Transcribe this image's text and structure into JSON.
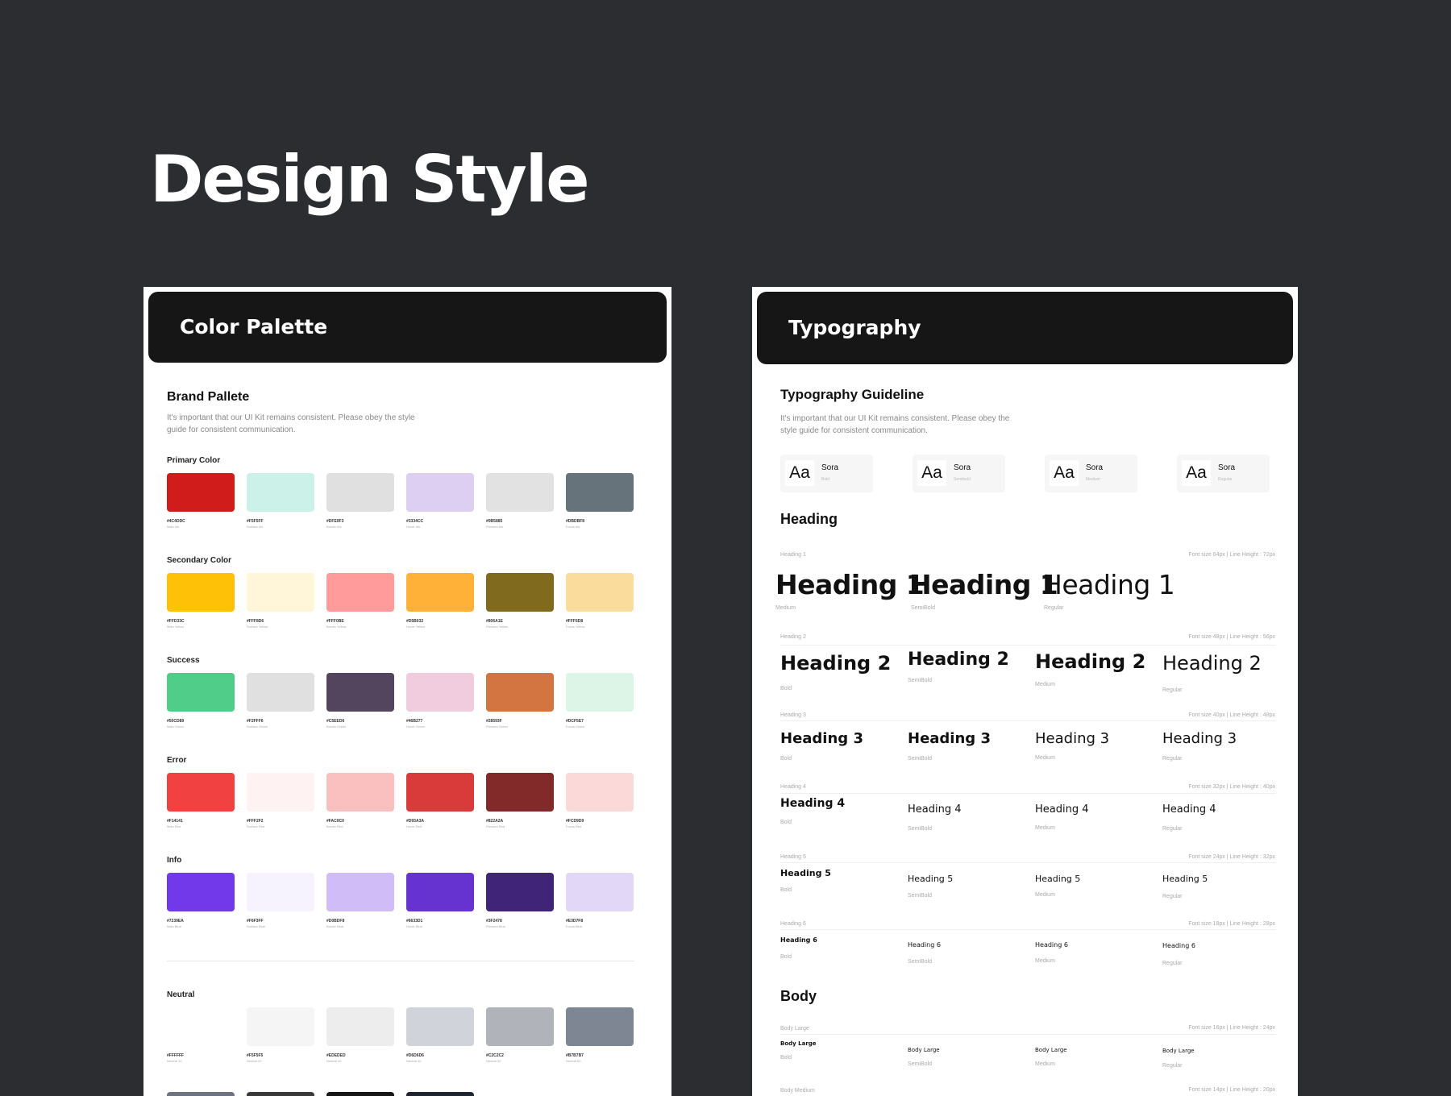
{
  "page": {
    "title": "Design Style"
  },
  "color_palette": {
    "header": "Color Palette",
    "title": "Brand Pallete",
    "description": "It's important that our UI Kit remains consistent. Please obey the style guide for consistent communication.",
    "groups": [
      {
        "label": "Primary Color",
        "swatches": [
          {
            "color": "#D11C1C",
            "hex": "#4C4DDC",
            "name": "Main Iris"
          },
          {
            "color": "#CBF1E8",
            "hex": "#F5F5FF",
            "name": "Surface Iris"
          },
          {
            "color": "#E0E0E0",
            "hex": "#DFE0F3",
            "name": "Border Iris"
          },
          {
            "color": "#DCCFF1",
            "hex": "#3334CC",
            "name": "Hover Iris"
          },
          {
            "color": "#E2E2E2",
            "hex": "#0B5885",
            "name": "Pressed Iris"
          },
          {
            "color": "#66737A",
            "hex": "#DBDBF8",
            "name": "Focus Iris"
          }
        ]
      },
      {
        "label": "Secondary Color",
        "swatches": [
          {
            "color": "#FFC107",
            "hex": "#FFD33C",
            "name": "Main Yellow"
          },
          {
            "color": "#FFF6DA",
            "hex": "#FFF8D6",
            "name": "Surface Yellow"
          },
          {
            "color": "#FF9B9B",
            "hex": "#FFF0BE",
            "name": "Border Yellow"
          },
          {
            "color": "#FFB237",
            "hex": "#D5B032",
            "name": "Hover Yellow"
          },
          {
            "color": "#806A1E",
            "hex": "#806A1E",
            "name": "Pressed Yellow"
          },
          {
            "color": "#FADD9D",
            "hex": "#FFF6D8",
            "name": "Focus Yellow"
          }
        ]
      },
      {
        "label": "Success",
        "swatches": [
          {
            "color": "#50CD89",
            "hex": "#50CD89",
            "name": "Main Green"
          },
          {
            "color": "#E0E0E0",
            "hex": "#F2FFF6",
            "name": "Surface Green"
          },
          {
            "color": "#54455F",
            "hex": "#C5EED6",
            "name": "Border Green"
          },
          {
            "color": "#F0CCDE",
            "hex": "#46B277",
            "name": "Hover Green"
          },
          {
            "color": "#D27540",
            "hex": "#28593F",
            "name": "Pressed Green"
          },
          {
            "color": "#DCF5E7",
            "hex": "#DCF5E7",
            "name": "Focus Green"
          }
        ]
      },
      {
        "label": "Error",
        "swatches": [
          {
            "color": "#F14141",
            "hex": "#F14141",
            "name": "Main Red"
          },
          {
            "color": "#FFF2F2",
            "hex": "#FFF2F2",
            "name": "Surface Red"
          },
          {
            "color": "#FAC0C0",
            "hex": "#FAC0C0",
            "name": "Border Red"
          },
          {
            "color": "#D93A3A",
            "hex": "#D93A3A",
            "name": "Hover Red"
          },
          {
            "color": "#822A2A",
            "hex": "#822A2A",
            "name": "Pressed Red"
          },
          {
            "color": "#FCD9D9",
            "hex": "#FCD9D9",
            "name": "Focus Red"
          }
        ]
      },
      {
        "label": "Info",
        "swatches": [
          {
            "color": "#7239EA",
            "hex": "#7239EA",
            "name": "Main Blue"
          },
          {
            "color": "#F6F3FF",
            "hex": "#F6F3FF",
            "name": "Surface Blue"
          },
          {
            "color": "#D0BDF8",
            "hex": "#D0BDF8",
            "name": "Border Blue"
          },
          {
            "color": "#6633D1",
            "hex": "#6633D1",
            "name": "Hover Blue"
          },
          {
            "color": "#3F2478",
            "hex": "#3F2478",
            "name": "Pressed Blue"
          },
          {
            "color": "#E3D7F8",
            "hex": "#E3D7F8",
            "name": "Focus Blue"
          }
        ]
      },
      {
        "label": "Neutral",
        "swatches": [
          {
            "color": "#FFFFFF",
            "hex": "#FFFFFF",
            "name": "Neutral 10"
          },
          {
            "color": "#F5F5F5",
            "hex": "#F5F5F5",
            "name": "Neutral 20"
          },
          {
            "color": "#EDEDED",
            "hex": "#EDEDED",
            "name": "Neutral 30"
          },
          {
            "color": "#D0D3D9",
            "hex": "#D6D6D6",
            "name": "Neutral 40"
          },
          {
            "color": "#B1B3BA",
            "hex": "#C2C2C2",
            "name": "Neutral 50"
          },
          {
            "color": "#7E8593",
            "hex": "#B7B7B7",
            "name": "Neutral 60"
          }
        ]
      }
    ],
    "neutral_extra": [
      "#6E7380",
      "#3A3A3A",
      "#161616",
      "#1E2530"
    ]
  },
  "typography": {
    "header": "Typography",
    "title": "Typography Guideline",
    "description": "It's important that our UI Kit remains consistent. Please obey the style guide for consistent communication.",
    "font_cards": [
      {
        "aa": "Aa",
        "name": "Sora",
        "weight": "Bold"
      },
      {
        "aa": "Aa",
        "name": "Sora",
        "weight": "Semibold"
      },
      {
        "aa": "Aa",
        "name": "Sora",
        "weight": "Medium"
      },
      {
        "aa": "Aa",
        "name": "Sora",
        "weight": "Regular"
      }
    ],
    "heading_section": "Heading",
    "headings": [
      {
        "label": "Heading 1",
        "spec": "Font size 64px | Line Height : 72px",
        "samples": [
          {
            "text": "Heading 1",
            "weight": "Medium"
          },
          {
            "text": "Heading 1",
            "weight": "SemiBold"
          },
          {
            "text": "Heading 1",
            "weight": "Regular"
          }
        ]
      },
      {
        "label": "Heading 2",
        "spec": "Font size 48px | Line Height : 56px",
        "samples": [
          {
            "text": "Heading 2",
            "weight": "Bold"
          },
          {
            "text": "Heading 2",
            "weight": "SemiBold"
          },
          {
            "text": "Heading 2",
            "weight": "Medium"
          },
          {
            "text": "Heading 2",
            "weight": "Regular"
          }
        ]
      },
      {
        "label": "Heading 3",
        "spec": "Font size 40px | Line Height : 48px",
        "samples": [
          {
            "text": "Heading 3",
            "weight": "Bold"
          },
          {
            "text": "Heading 3",
            "weight": "SemiBold"
          },
          {
            "text": "Heading 3",
            "weight": "Medium"
          },
          {
            "text": "Heading 3",
            "weight": "Regular"
          }
        ]
      },
      {
        "label": "Heading 4",
        "spec": "Font size 32px | Line Height : 40px",
        "samples": [
          {
            "text": "Heading 4",
            "weight": "Bold"
          },
          {
            "text": "Heading 4",
            "weight": "SemiBold"
          },
          {
            "text": "Heading 4",
            "weight": "Medium"
          },
          {
            "text": "Heading 4",
            "weight": "Regular"
          }
        ]
      },
      {
        "label": "Heading 5",
        "spec": "Font size 24px | Line Height : 32px",
        "samples": [
          {
            "text": "Heading 5",
            "weight": "Bold"
          },
          {
            "text": "Heading 5",
            "weight": "SemiBold"
          },
          {
            "text": "Heading 5",
            "weight": "Medium"
          },
          {
            "text": "Heading 5",
            "weight": "Regular"
          }
        ]
      },
      {
        "label": "Heading 6",
        "spec": "Font size 18px | Line Height : 28px",
        "samples": [
          {
            "text": "Heading 6",
            "weight": "Bold"
          },
          {
            "text": "Heading 6",
            "weight": "SemiBold"
          },
          {
            "text": "Heading 6",
            "weight": "Medium"
          },
          {
            "text": "Heading 6",
            "weight": "Regular"
          }
        ]
      }
    ],
    "body_section": "Body",
    "body": [
      {
        "label": "Body Large",
        "spec": "Font size 16px | Line Height : 24px",
        "samples": [
          {
            "text": "Body Large",
            "weight": "Bold"
          },
          {
            "text": "Body Large",
            "weight": "SemiBold"
          },
          {
            "text": "Body Large",
            "weight": "Medium"
          },
          {
            "text": "Body Large",
            "weight": "Regular"
          }
        ]
      },
      {
        "label": "Body Medium",
        "spec": "Font size 14px | Line Height : 20px"
      }
    ]
  }
}
